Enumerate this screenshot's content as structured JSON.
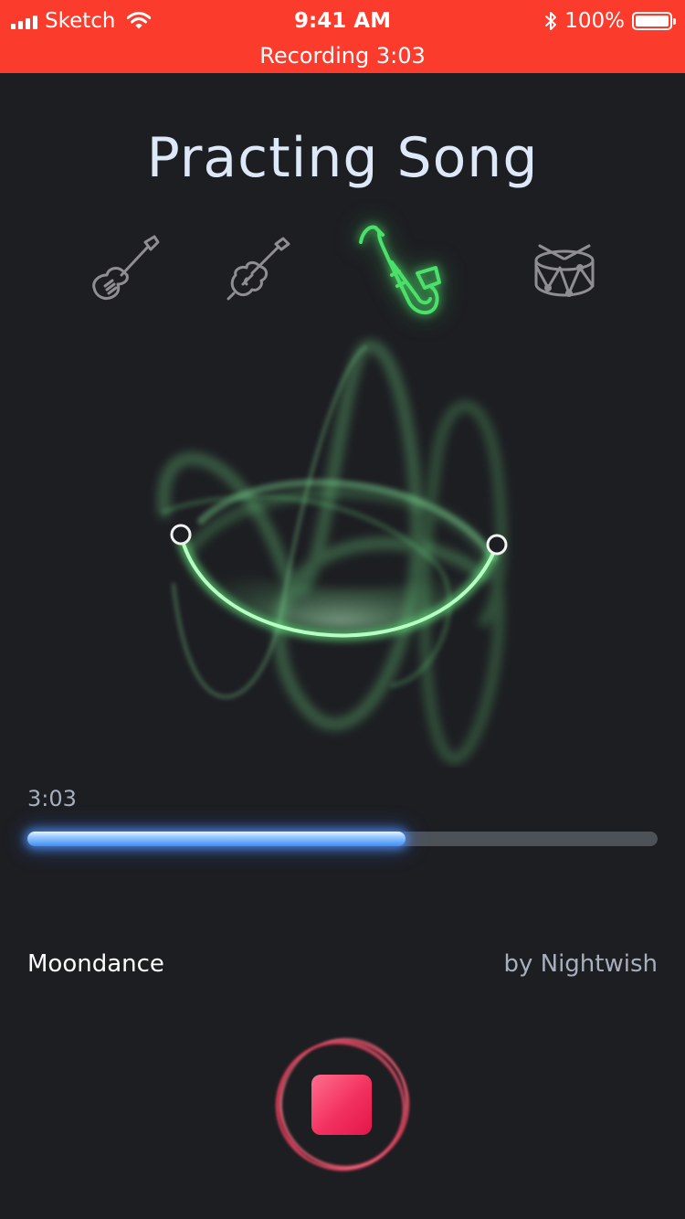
{
  "status_bar": {
    "carrier": "Sketch",
    "time": "9:41 AM",
    "battery": "100%",
    "recording": "Recording 3:03"
  },
  "title": "Practing Song",
  "instruments": [
    {
      "icon": "electric-guitar-icon",
      "active": false
    },
    {
      "icon": "violin-icon",
      "active": false
    },
    {
      "icon": "saxophone-icon",
      "active": true
    },
    {
      "icon": "drum-icon",
      "active": false
    }
  ],
  "player": {
    "elapsed": "3:03",
    "progress": 0.6
  },
  "song": {
    "name": "Moondance",
    "artist": "by Nightwish"
  },
  "colors": {
    "status_bar": "#fb3b2c",
    "background": "#1d1e22",
    "active_instrument": "#4be06a",
    "inactive_instrument": "#8e8e93",
    "progress": "#3f8ef5",
    "stop": "#f2315f"
  }
}
